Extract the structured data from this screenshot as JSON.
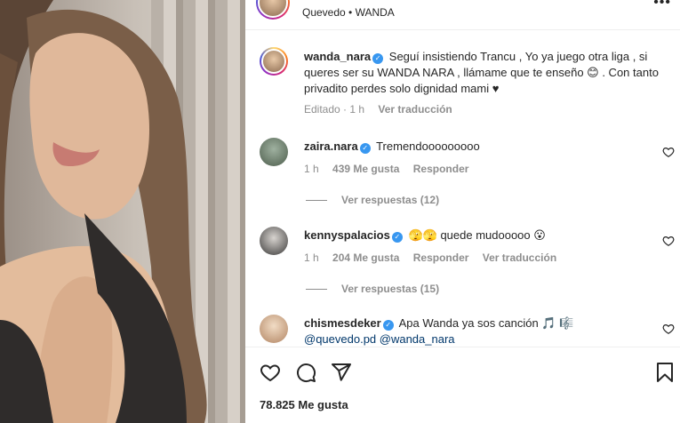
{
  "header": {
    "location": "Quevedo • WANDA"
  },
  "caption": {
    "username": "wanda_nara",
    "text": "Seguí insistiendo Trancu , Yo ya juego otra liga , si queres ser su WANDA NARA , llámame que te enseño 😊 . Con tanto privadito perdes solo dignidad mami ♥",
    "edited": "Editado · 1 h",
    "translate": "Ver traducción"
  },
  "comments": [
    {
      "username": "zaira.nara",
      "text": "Tremendooooooooo",
      "time": "1 h",
      "likes": "439 Me gusta",
      "reply": "Responder",
      "replies": "Ver respuestas (12)"
    },
    {
      "username": "kennyspalacios",
      "text": "🫣🫣 quede mudooooo 😮",
      "time": "1 h",
      "likes": "204 Me gusta",
      "reply": "Responder",
      "translate": "Ver traducción",
      "replies": "Ver respuestas (15)"
    },
    {
      "username": "chismesdeker",
      "text": "Apa Wanda ya sos canción 🎵 🎼",
      "mentions": "@quevedo.pd @wanda_nara"
    }
  ],
  "footer": {
    "likes_count": "78.825 Me gusta"
  },
  "icons": {
    "heart": "heart-icon",
    "comment": "comment-icon",
    "share": "share-icon",
    "save": "bookmark-icon",
    "more": "more-icon",
    "verified": "verified-badge-icon"
  },
  "colors": {
    "verified": "#3897f0",
    "muted": "#8e8e8e",
    "text": "#262626",
    "mention": "#00376b"
  }
}
